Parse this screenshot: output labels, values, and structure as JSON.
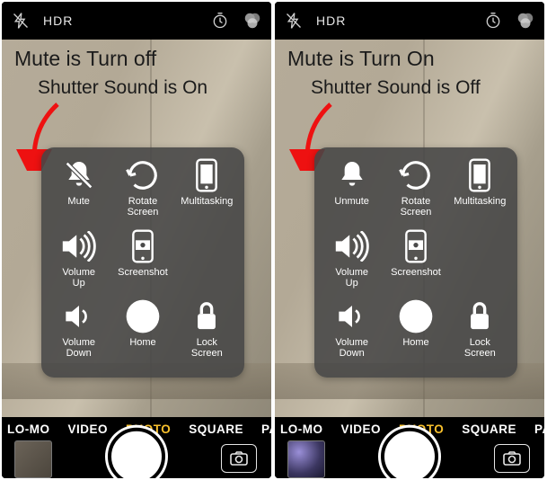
{
  "screens": [
    {
      "annot1": "Mute is Turn off",
      "annot2": "Shutter Sound is On",
      "muteLabel": "Mute",
      "muteSlashed": true,
      "thumbVariant": "a"
    },
    {
      "annot1": "Mute is Turn On",
      "annot2": "Shutter Sound is Off",
      "muteLabel": "Unmute",
      "muteSlashed": false,
      "thumbVariant": "b"
    }
  ],
  "topbar": {
    "hdr": "HDR"
  },
  "panel": {
    "rotate": "Rotate\nScreen",
    "multitask": "Multitasking",
    "volUp": "Volume\nUp",
    "screenshot": "Screenshot",
    "volDown": "Volume\nDown",
    "home": "Home",
    "lock": "Lock\nScreen"
  },
  "modes": {
    "slomo": "LO-MO",
    "video": "VIDEO",
    "photo": "PHOTO",
    "square": "SQUARE",
    "pano": "PAN"
  }
}
